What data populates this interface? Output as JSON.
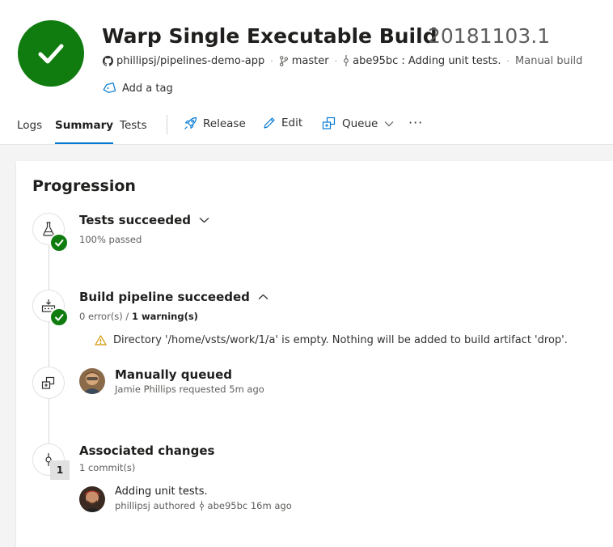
{
  "header": {
    "title": "Warp Single Executable Build",
    "build_number": "20181103.1",
    "repo": "phillipsj/pipelines-demo-app",
    "branch": "master",
    "commit": "abe95bc : Adding unit tests.",
    "trigger": "Manual build",
    "add_tag": "Add a tag",
    "status_color": "#107c10"
  },
  "tabs": {
    "logs": "Logs",
    "summary": "Summary",
    "tests": "Tests"
  },
  "actions": {
    "release": "Release",
    "edit": "Edit",
    "queue": "Queue",
    "more": "···"
  },
  "progression": {
    "title": "Progression",
    "tests": {
      "title": "Tests succeeded",
      "subtitle": "100% passed"
    },
    "build": {
      "title": "Build pipeline succeeded",
      "errors": "0 error(s) / ",
      "warnings": "1 warning(s)",
      "warning_message": "Directory '/home/vsts/work/1/a' is empty. Nothing will be added to build artifact 'drop'."
    },
    "queued": {
      "title": "Manually queued",
      "subtitle": "Jamie Phillips requested 5m ago"
    },
    "changes": {
      "title": "Associated changes",
      "subtitle": "1 commit(s)",
      "count": "1",
      "commit_message": "Adding unit tests.",
      "commit_author": "phillipsj authored",
      "commit_id_time": "abe95bc 16m ago"
    }
  },
  "icons": {
    "status": "check-icon",
    "repo": "github-icon",
    "branch": "branch-icon",
    "commit": "commit-icon",
    "tag": "tag-icon",
    "release": "rocket-icon",
    "edit": "pencil-icon",
    "queue": "queue-icon",
    "tests": "flask-icon",
    "build": "build-icon",
    "warning": "warning-icon"
  }
}
